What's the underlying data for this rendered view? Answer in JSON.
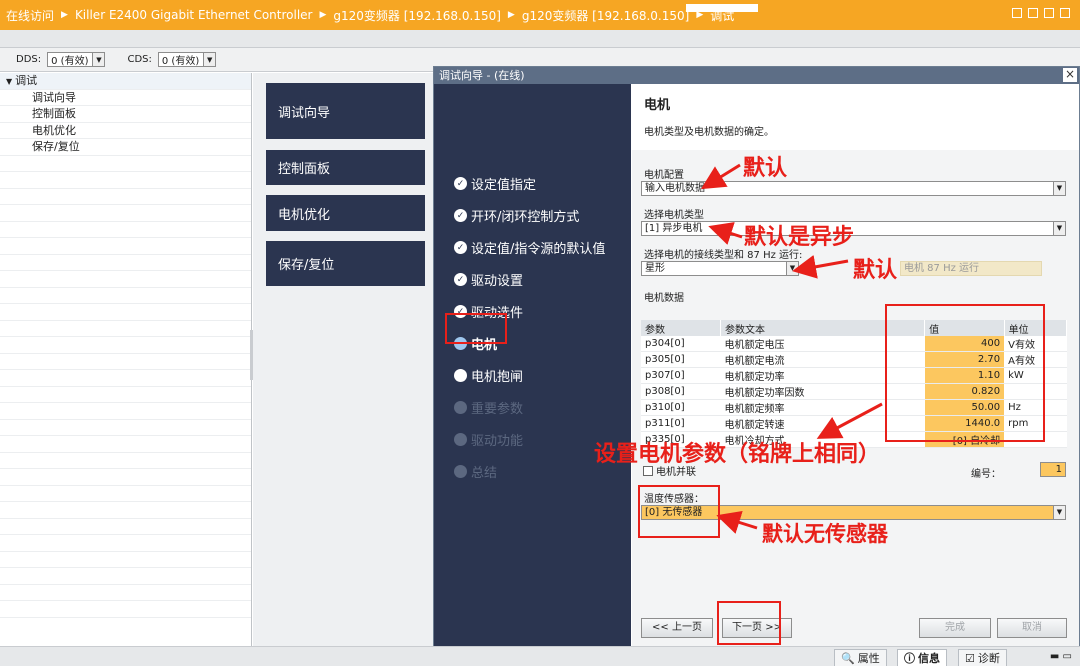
{
  "topbar": {
    "crumbs": [
      "在线访问",
      "Killer E2400 Gigabit Ethernet Controller",
      "g120变频器 [192.168.0.150]",
      "g120变频器 [192.168.0.150]",
      "调试"
    ]
  },
  "ddsbar": {
    "dds_label": "DDS:",
    "dds_value": "0 (有效)",
    "cds_label": "CDS:",
    "cds_value": "0 (有效)"
  },
  "tree": {
    "root": "调试",
    "children": [
      "调试向导",
      "控制面板",
      "电机优化",
      "保存/复位"
    ]
  },
  "nav": [
    "调试向导",
    "控制面板",
    "电机优化",
    "保存/复位"
  ],
  "dialog": {
    "title": "调试向导 - (在线)",
    "close": "×",
    "steps": [
      "设定值指定",
      "开环/闭环控制方式",
      "设定值/指令源的默认值",
      "驱动设置",
      "驱动选件",
      "电机",
      "电机抱闸",
      "重要参数",
      "驱动功能",
      "总结"
    ],
    "header_title": "电机",
    "header_desc": "电机类型及电机数据的确定。",
    "motor_config_label": "电机配置",
    "motor_config_value": "输入电机数据",
    "motor_type_label": "选择电机类型",
    "motor_type_value": "[1] 异步电机",
    "connection_label": "选择电机的接线类型和 87 Hz 运行:",
    "connection_value": "星形",
    "hz87_label": "电机 87 Hz 运行",
    "motor_data_label": "电机数据",
    "table_headers": [
      "参数",
      "参数文本",
      "值",
      "单位"
    ],
    "table_rows": [
      [
        "p304[0]",
        "电机额定电压",
        "400",
        "V有效"
      ],
      [
        "p305[0]",
        "电机额定电流",
        "2.70",
        "A有效"
      ],
      [
        "p307[0]",
        "电机额定功率",
        "1.10",
        "kW"
      ],
      [
        "p308[0]",
        "电机额定功率因数",
        "0.820",
        ""
      ],
      [
        "p310[0]",
        "电机额定频率",
        "50.00",
        "Hz"
      ],
      [
        "p311[0]",
        "电机额定转速",
        "1440.0",
        "rpm"
      ],
      [
        "p335[0]",
        "电机冷却方式",
        "[0] 自冷却",
        ""
      ]
    ],
    "parallel_label": "电机并联",
    "number_label": "编号：",
    "number_value": "1",
    "temp_sensor_label": "温度传感器：",
    "temp_sensor_value": "[0] 无传感器",
    "btn_prev": "<< 上一页",
    "btn_next": "下一页 >>",
    "btn_finish": "完成",
    "btn_cancel": "取消"
  },
  "annotations": {
    "a1": "默认",
    "a2": "默认是异步",
    "a3": "默认",
    "a4": "设置电机参数（铭牌上相同）",
    "a5": "默认无传感器"
  },
  "bottom_tabs": [
    "属性",
    "信息",
    "诊断"
  ],
  "colors": {
    "accent_orange": "#f6a623",
    "nav_dark": "#2b3550",
    "field_orange": "#fcc75f",
    "annotation_red": "#e8201a"
  }
}
